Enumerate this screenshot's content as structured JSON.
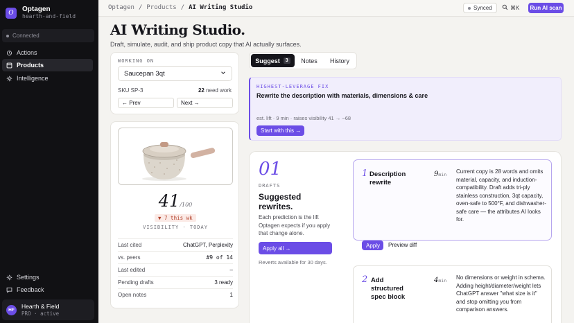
{
  "app": {
    "name": "Optagen",
    "sub": "hearth-and-field",
    "logo_letter": "O"
  },
  "sidebar": {
    "connection": "Connected",
    "items": [
      {
        "label": "Actions",
        "icon": "lightning-icon"
      },
      {
        "label": "Products",
        "icon": "products-icon"
      },
      {
        "label": "Intelligence",
        "icon": "sparkle-icon"
      }
    ],
    "bottom": [
      {
        "label": "Settings",
        "icon": "gear-icon"
      },
      {
        "label": "Feedback",
        "icon": "chat-icon"
      }
    ],
    "user": {
      "initials": "HF",
      "name": "Hearth & Field",
      "plan": "PRO · active"
    }
  },
  "topbar": {
    "crumbs": [
      "Optagen",
      "/",
      "Products",
      "/"
    ],
    "current": "AI Writing Studio",
    "synced": "Synced",
    "shortcut": "⌘K",
    "run_scan": "Run AI scan"
  },
  "header": {
    "title": "AI Writing Studio.",
    "subtitle": "Draft, simulate, audit, and ship product copy that AI actually surfaces."
  },
  "working": {
    "label": "WORKING ON",
    "product": "Saucepan 3qt",
    "sku": "SKU SP-3",
    "need_count": "22",
    "need_label": "need work",
    "prev": "← Prev",
    "next": "Next →"
  },
  "visibility": {
    "score": "41",
    "out_of": "/100",
    "delta": "▼ 7 this wk",
    "label": "VISIBILITY · TODAY",
    "rows": [
      {
        "k": "Last cited",
        "v": "ChatGPT, Perplexity"
      },
      {
        "k": "vs. peers",
        "v": "#9 of 14"
      },
      {
        "k": "Last edited",
        "v": "–"
      },
      {
        "k": "Pending drafts",
        "v": "3 ready"
      },
      {
        "k": "Open notes",
        "v": "1"
      }
    ]
  },
  "tabs": [
    {
      "label": "Suggest",
      "badge": "3"
    },
    {
      "label": "Notes"
    },
    {
      "label": "History"
    }
  ],
  "fix": {
    "label": "HIGHEST-LEVERAGE FIX",
    "headline": "Rewrite the description with materials, dimensions & care",
    "meta": "est. lift · 9 min · raises visibility 41 → ~68",
    "cta": "Start with this →"
  },
  "drafts": {
    "number": "01",
    "label": "DRAFTS",
    "heading": "Suggested rewrites.",
    "body": "Each prediction is the lift Optagen expects if you apply that change alone.",
    "apply_all": "Apply all →",
    "reverts": "Reverts available for 30 days."
  },
  "rewrites": [
    {
      "n": "1",
      "title": "Description rewrite",
      "mins": "9",
      "unit": "min",
      "body": "Current copy is 28 words and omits material, capacity, and induction-compatibility. Draft adds tri-ply stainless construction, 3qt capacity, oven-safe to 500°F, and dishwasher-safe care — the attributes AI looks for.",
      "apply": "Apply",
      "preview": "Preview diff"
    },
    {
      "n": "2",
      "title": "Add structured spec block",
      "mins": "4",
      "unit": "min",
      "body": "No dimensions or weight in schema. Adding height/diameter/weight lets ChatGPT answer \"what size is it\" and stop omitting you from comparison answers."
    }
  ],
  "colors": {
    "accent": "#6b4de6",
    "sidebar": "#111114",
    "delta_bg": "#fbeae6",
    "delta_fg": "#b2402a"
  }
}
